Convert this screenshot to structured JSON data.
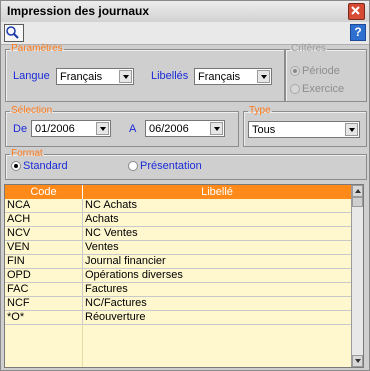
{
  "window": {
    "title": "Impression des journaux"
  },
  "toolbar": {
    "search_icon": "magnifier-icon",
    "help_label": "?"
  },
  "parametres": {
    "legend": "Paramètres",
    "langue_label": "Langue",
    "langue_value": "Français",
    "libelles_label": "Libellés",
    "libelles_value": "Français"
  },
  "criteres": {
    "legend": "Critères",
    "periode_label": "Période",
    "exercice_label": "Exercice"
  },
  "selection": {
    "legend": "Sélection",
    "de_label": "De",
    "de_value": "01/2006",
    "a_label": "A",
    "a_value": "06/2006"
  },
  "type": {
    "legend": "Type",
    "value": "Tous"
  },
  "format": {
    "legend": "Format",
    "standard_label": "Standard",
    "presentation_label": "Présentation"
  },
  "grid": {
    "columns": [
      "Code",
      "Libellé"
    ],
    "rows": [
      [
        "NCA",
        "NC Achats"
      ],
      [
        "ACH",
        "Achats"
      ],
      [
        "NCV",
        "NC Ventes"
      ],
      [
        "VEN",
        "Ventes"
      ],
      [
        "FIN",
        "Journal financier"
      ],
      [
        "OPD",
        "Opérations diverses"
      ],
      [
        "FAC",
        "Factures"
      ],
      [
        "NCF",
        "NC/Factures"
      ],
      [
        "*O*",
        "Réouverture"
      ]
    ]
  },
  "colors": {
    "accent": "#ff8a1a",
    "grid_bg": "#fff8cf",
    "label_blue": "#1a2bd8"
  }
}
